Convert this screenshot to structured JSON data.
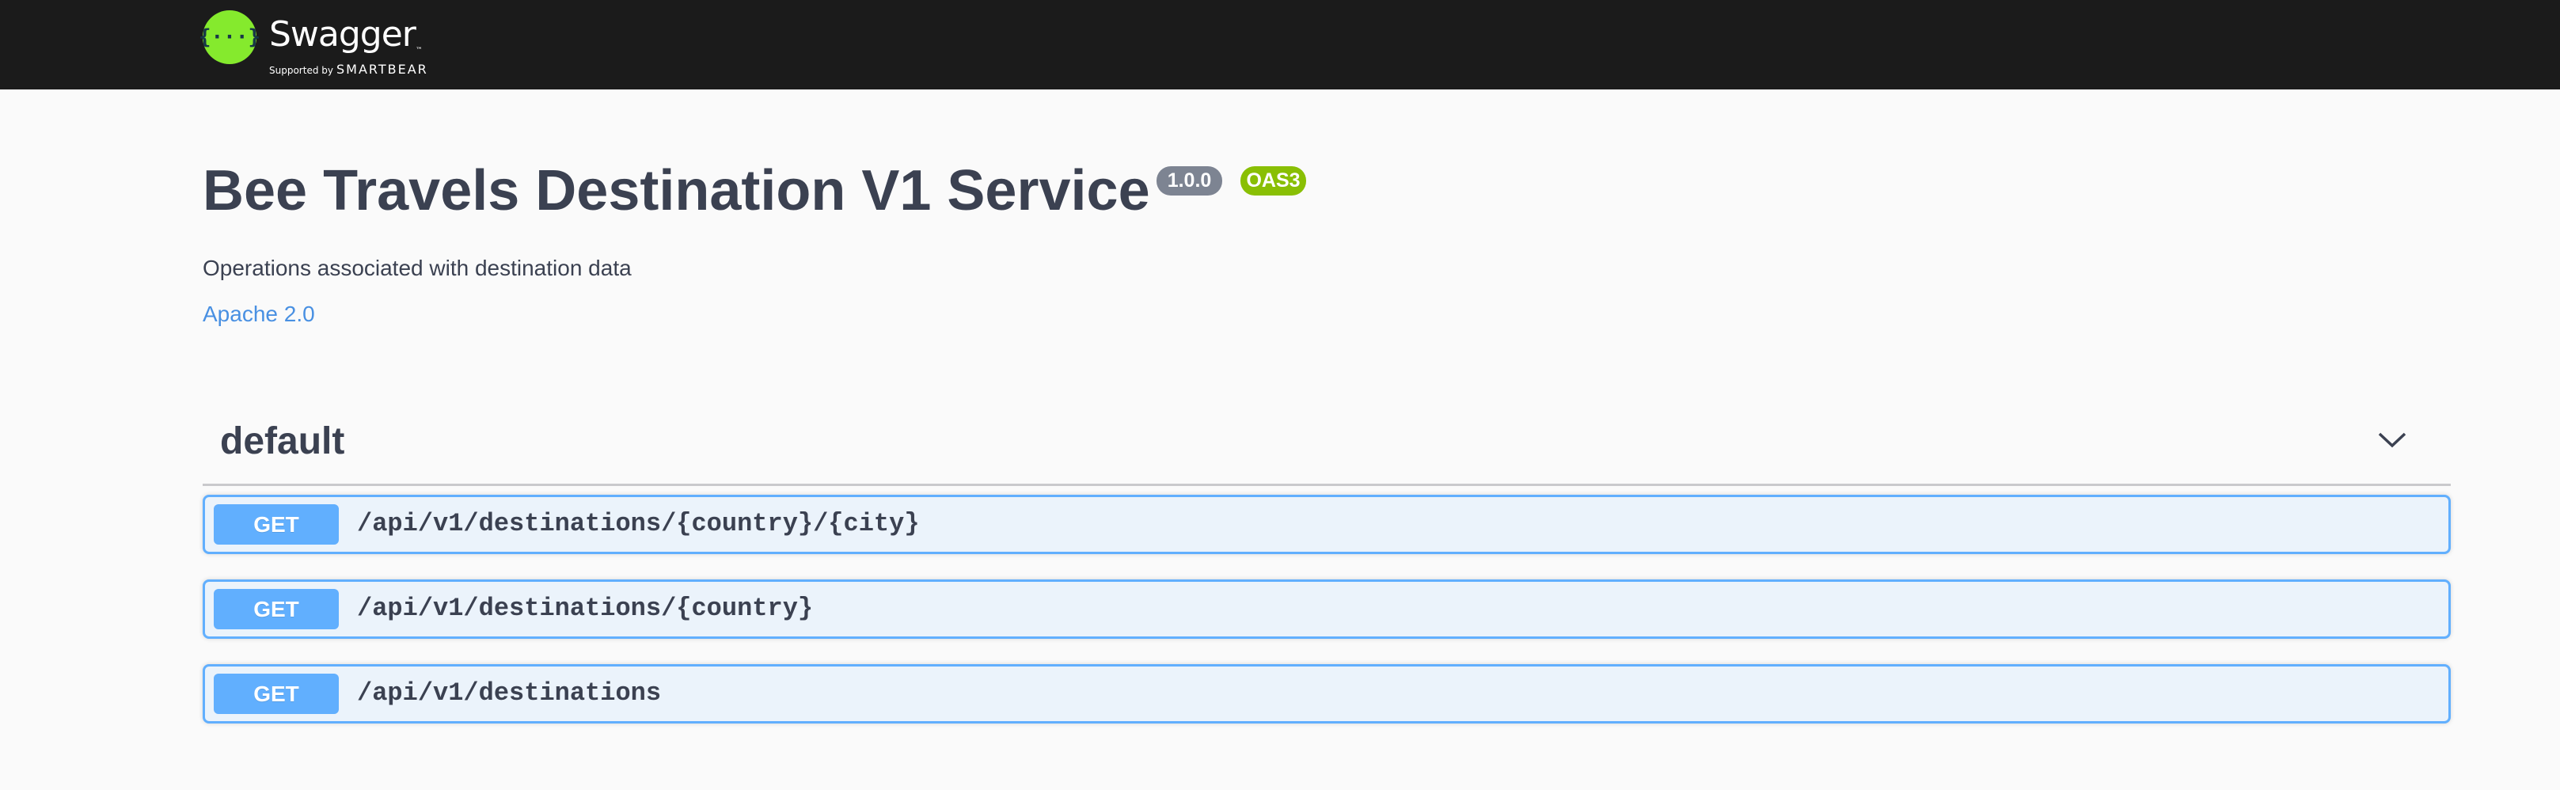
{
  "topbar": {
    "logo_icon": "swagger-braces-icon",
    "logo_glyph": "{···}",
    "brand": "Swagger",
    "trademark": "™",
    "supported_by": "Supported by",
    "company": "SMARTBEAR"
  },
  "info": {
    "title": "Bee Travels Destination V1 Service",
    "version": "1.0.0",
    "oas": "OAS3",
    "description": "Operations associated with destination data",
    "license": "Apache 2.0"
  },
  "colors": {
    "topbar": "#1b1b1b",
    "get": "#61affe",
    "version_badge": "#7d8492",
    "oas_badge": "#89bf04",
    "link": "#4990e2"
  },
  "tag": {
    "name": "default",
    "expand_icon": "chevron-down-icon"
  },
  "operations": [
    {
      "method": "GET",
      "path": "/api/v1/destinations/{country}/{city}"
    },
    {
      "method": "GET",
      "path": "/api/v1/destinations/{country}"
    },
    {
      "method": "GET",
      "path": "/api/v1/destinations"
    }
  ]
}
